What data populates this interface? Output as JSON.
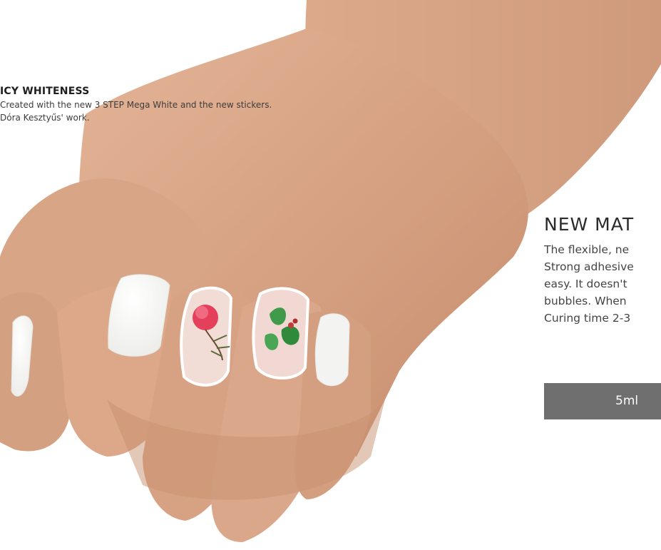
{
  "caption": {
    "title": "ICY WHITENESS",
    "line1": "Created with the new 3 STEP Mega White and the new stickers.",
    "line2": "Dóra Kesztyűs' work."
  },
  "product": {
    "title": "NEW MAT",
    "desc_lines": [
      "The flexible, ne",
      "Strong adhesive",
      "easy. It doesn't",
      "bubbles. When",
      "Curing time 2-3"
    ],
    "size_label": "5ml"
  },
  "colors": {
    "skin": "#d9a789",
    "nail_white": "#f7f7f5",
    "button_bg": "#6f6f6f"
  }
}
